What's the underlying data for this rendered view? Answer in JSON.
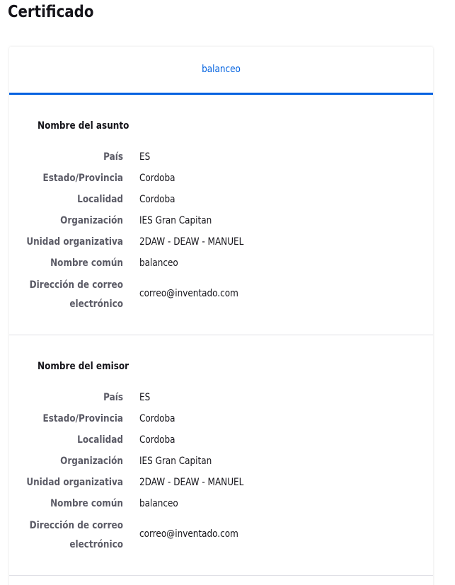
{
  "page": {
    "title": "Certificado"
  },
  "tabs": [
    {
      "label": "balanceo"
    }
  ],
  "subject": {
    "heading": "Nombre del asunto",
    "rows": [
      {
        "label": "País",
        "value": "ES"
      },
      {
        "label": "Estado/Provincia",
        "value": "Cordoba"
      },
      {
        "label": "Localidad",
        "value": "Cordoba"
      },
      {
        "label": "Organización",
        "value": "IES Gran Capitan"
      },
      {
        "label": "Unidad organizativa",
        "value": "2DAW - DEAW - MANUEL"
      },
      {
        "label": "Nombre común",
        "value": "balanceo"
      },
      {
        "label": "Dirección de correo electrónico",
        "value": "correo@inventado.com"
      }
    ]
  },
  "issuer": {
    "heading": "Nombre del emisor",
    "rows": [
      {
        "label": "País",
        "value": "ES"
      },
      {
        "label": "Estado/Provincia",
        "value": "Cordoba"
      },
      {
        "label": "Localidad",
        "value": "Cordoba"
      },
      {
        "label": "Organización",
        "value": "IES Gran Capitan"
      },
      {
        "label": "Unidad organizativa",
        "value": "2DAW - DEAW - MANUEL"
      },
      {
        "label": "Nombre común",
        "value": "balanceo"
      },
      {
        "label": "Dirección de correo electrónico",
        "value": "correo@inventado.com"
      }
    ]
  },
  "colors": {
    "accent": "#0061e0",
    "label": "#5b5b66",
    "text": "#15141a",
    "divider": "#e0e0e6"
  }
}
